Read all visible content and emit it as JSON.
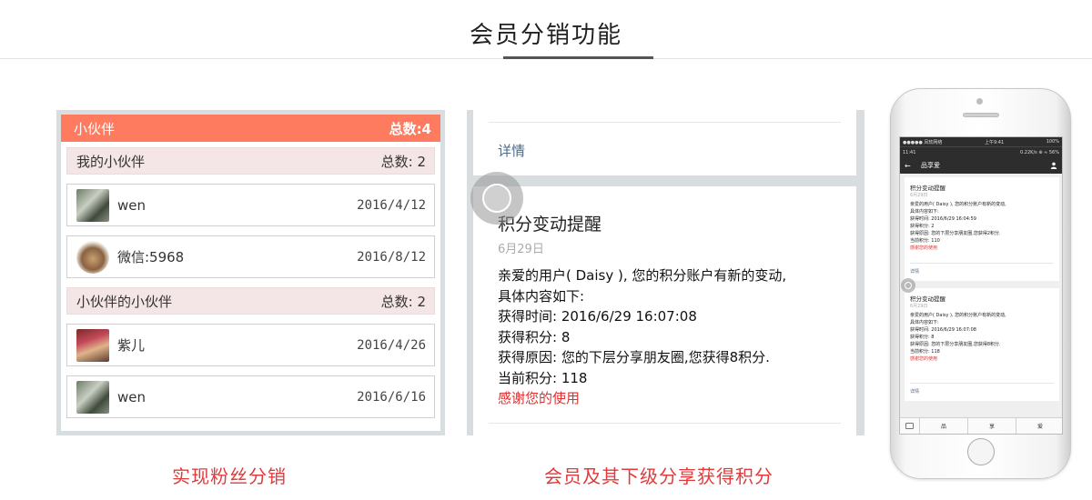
{
  "header": {
    "title": "会员分销功能"
  },
  "panel1": {
    "title": "小伙伴",
    "total": "总数:4",
    "groups": [
      {
        "label": "我的小伙伴",
        "count": "总数: 2"
      },
      {
        "label": "小伙伴的小伙伴",
        "count": "总数: 2"
      }
    ],
    "members": [
      {
        "name": "wen",
        "date": "2016/4/12"
      },
      {
        "name": "微信:5968",
        "date": "2016/8/12"
      },
      {
        "name": "紫儿",
        "date": "2016/4/26"
      },
      {
        "name": "wen",
        "date": "2016/6/16"
      }
    ],
    "caption": "实现粉丝分销"
  },
  "panel2": {
    "detail_link": "详情",
    "message": {
      "title": "积分变动提醒",
      "date": "6月29日",
      "lines": [
        "亲爱的用户(    Daisy    ), 您的积分账户有新的变动,",
        "具体内容如下:",
        "获得时间: 2016/6/29 16:07:08",
        "获得积分: 8",
        "获得原因: 您的下层分享朋友圈,您获得8积分.",
        "当前积分: 118"
      ],
      "thanks": "感谢您的使用"
    },
    "caption": "会员及其下级分享获得积分"
  },
  "phone": {
    "status": {
      "carrier": "●●●●● 凤软网络",
      "time": "上午9:41",
      "battery": "100%"
    },
    "status2": {
      "left": "11:41",
      "right": "0.22K/s ⊕ ≈ 56%"
    },
    "nav_title": "品享爱",
    "cards": [
      {
        "title": "积分变动提醒",
        "date": "6月29日",
        "lines": [
          "亲爱的用户(    Daisy    ), 您的积分账户有新的变动,",
          "具体内容如下:",
          "获得时间: 2016/6/29 16:04:59",
          "获得积分: 2",
          "获得原因: 您的下层分享朋友圈,您获得2积分.",
          "当前积分: 110"
        ],
        "thanks": "感谢您的使用",
        "detail": "详情"
      },
      {
        "title": "积分变动提醒",
        "date": "6月29日",
        "lines": [
          "亲爱的用户(    Daisy    ), 您的积分账户有新的变动,",
          "具体内容如下:",
          "获得时间: 2016/6/29 16:07:08",
          "获得积分: 8",
          "获得原因: 您的下层分享朋友圈,您获得8积分.",
          "当前积分: 118"
        ],
        "thanks": "感谢您的使用",
        "detail": "详情"
      }
    ],
    "tabs": [
      "品",
      "享",
      "爱"
    ]
  }
}
